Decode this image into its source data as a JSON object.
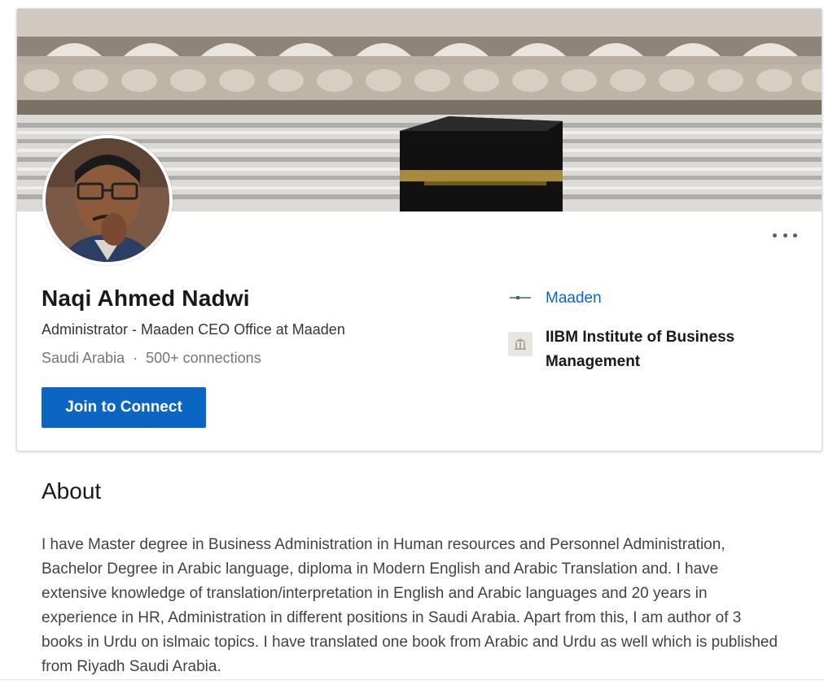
{
  "profile": {
    "name": "Naqi Ahmed Nadwi",
    "headline": "Administrator - Maaden CEO Office at Maaden",
    "location": "Saudi Arabia",
    "separator": "·",
    "connections": "500+ connections",
    "connect_button": "Join to Connect",
    "more_icon": "more-horizontal-icon"
  },
  "organizations": {
    "company": {
      "name": "Maaden",
      "icon": "company-logo-icon"
    },
    "school": {
      "name": "IIBM Institute of Business Management",
      "icon": "school-building-icon"
    }
  },
  "about": {
    "title": "About",
    "text": "I have Master degree in Business Administration in Human resources and Personnel Administration, Bachelor Degree in Arabic language, diploma in Modern English and Arabic Translation and. I have extensive knowledge of translation/interpretation in English and Arabic languages and 20 years in experience in HR, Administration in different positions in Saudi Arabia. Apart from this, I am author of 3 books in Urdu on islmaic topics. I have translated one book from Arabic and Urdu as well which is published from Riyadh Saudi Arabia."
  },
  "colors": {
    "accent": "#0a66c2",
    "card_border": "#dcdcdc",
    "muted_text": "#737373"
  }
}
